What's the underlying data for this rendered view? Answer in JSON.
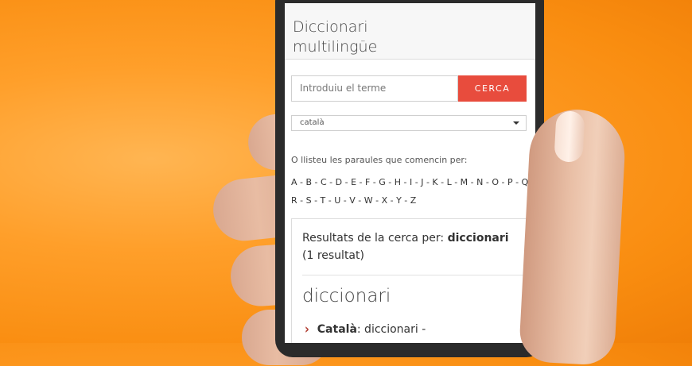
{
  "app": {
    "title": "Diccionari multilingüe"
  },
  "search": {
    "placeholder": "Introduiu el terme",
    "button_label": "CERCA"
  },
  "language_select": {
    "selected": "català"
  },
  "browse": {
    "intro": "O llisteu les paraules que comencin per:",
    "letters_row1": "A - B - C - D - E - F - G - H - I - J - K - L - M - N - O - P - Q -",
    "letters_row2": "R - S - T - U - V - W - X - Y - Z"
  },
  "results": {
    "prefix": "Resultats de la cerca per: ",
    "query": "diccionari",
    "count_text": " (1 resultat)",
    "word": "diccionari",
    "entry_language": "Català",
    "entry_text": ": diccionari -"
  }
}
